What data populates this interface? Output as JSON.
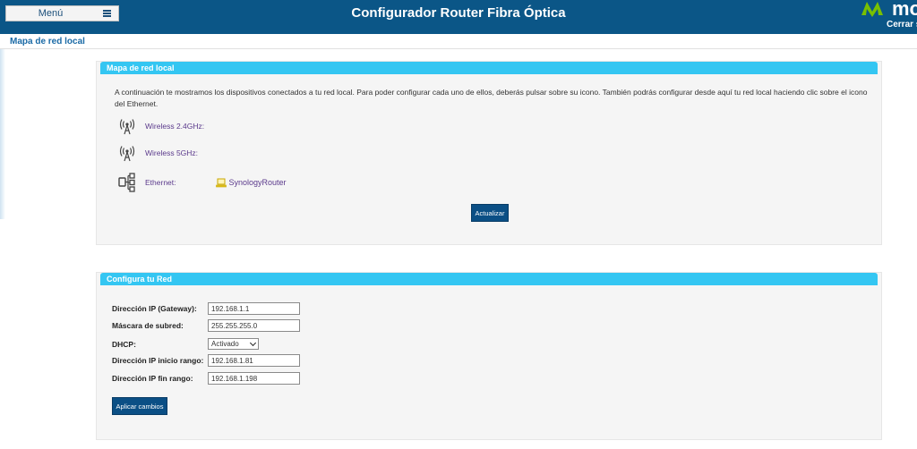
{
  "header": {
    "menu_label": "Menú",
    "title": "Configurador Router Fibra Óptica",
    "brand_text": "mo",
    "logout_label": "Cerrar se",
    "colors": {
      "bar": "#0b5687",
      "accent": "#34c6f2",
      "brand_green": "#79c000"
    }
  },
  "breadcrumb": {
    "title": "Mapa de red local"
  },
  "network_map": {
    "title": "Mapa de red local",
    "intro": "A continuación te mostramos los dispositivos conectados a tu red local. Para poder configurar cada uno de ellos, deberás pulsar sobre su icono. También podrás configurar desde aquí tu red local haciendo clic sobre el icono del Ethernet.",
    "wireless_24": {
      "label": "Wireless 2.4GHz:",
      "icon": "wifi-antenna-icon"
    },
    "wireless_5": {
      "label": "Wireless 5GHz:",
      "icon": "wifi-antenna-icon"
    },
    "ethernet": {
      "label": "Ethernet:",
      "icon": "ethernet-switch-icon",
      "device_name": "SynologyRouter",
      "device_icon": "laptop-icon"
    },
    "refresh_label": "Actualizar"
  },
  "network_config": {
    "title": "Configura tu Red",
    "fields": {
      "gateway": {
        "label": "Dirección IP (Gateway):",
        "value": "192.168.1.1"
      },
      "subnet": {
        "label": "Máscara de subred:",
        "value": "255.255.255.0"
      },
      "dhcp": {
        "label": "DHCP:",
        "value": "Activado"
      },
      "range_start": {
        "label": "Dirección IP inicio rango:",
        "value": "192.168.1.81"
      },
      "range_end": {
        "label": "Dirección IP fin rango:",
        "value": "192.168.1.198"
      }
    },
    "apply_label": "Aplicar cambios"
  }
}
